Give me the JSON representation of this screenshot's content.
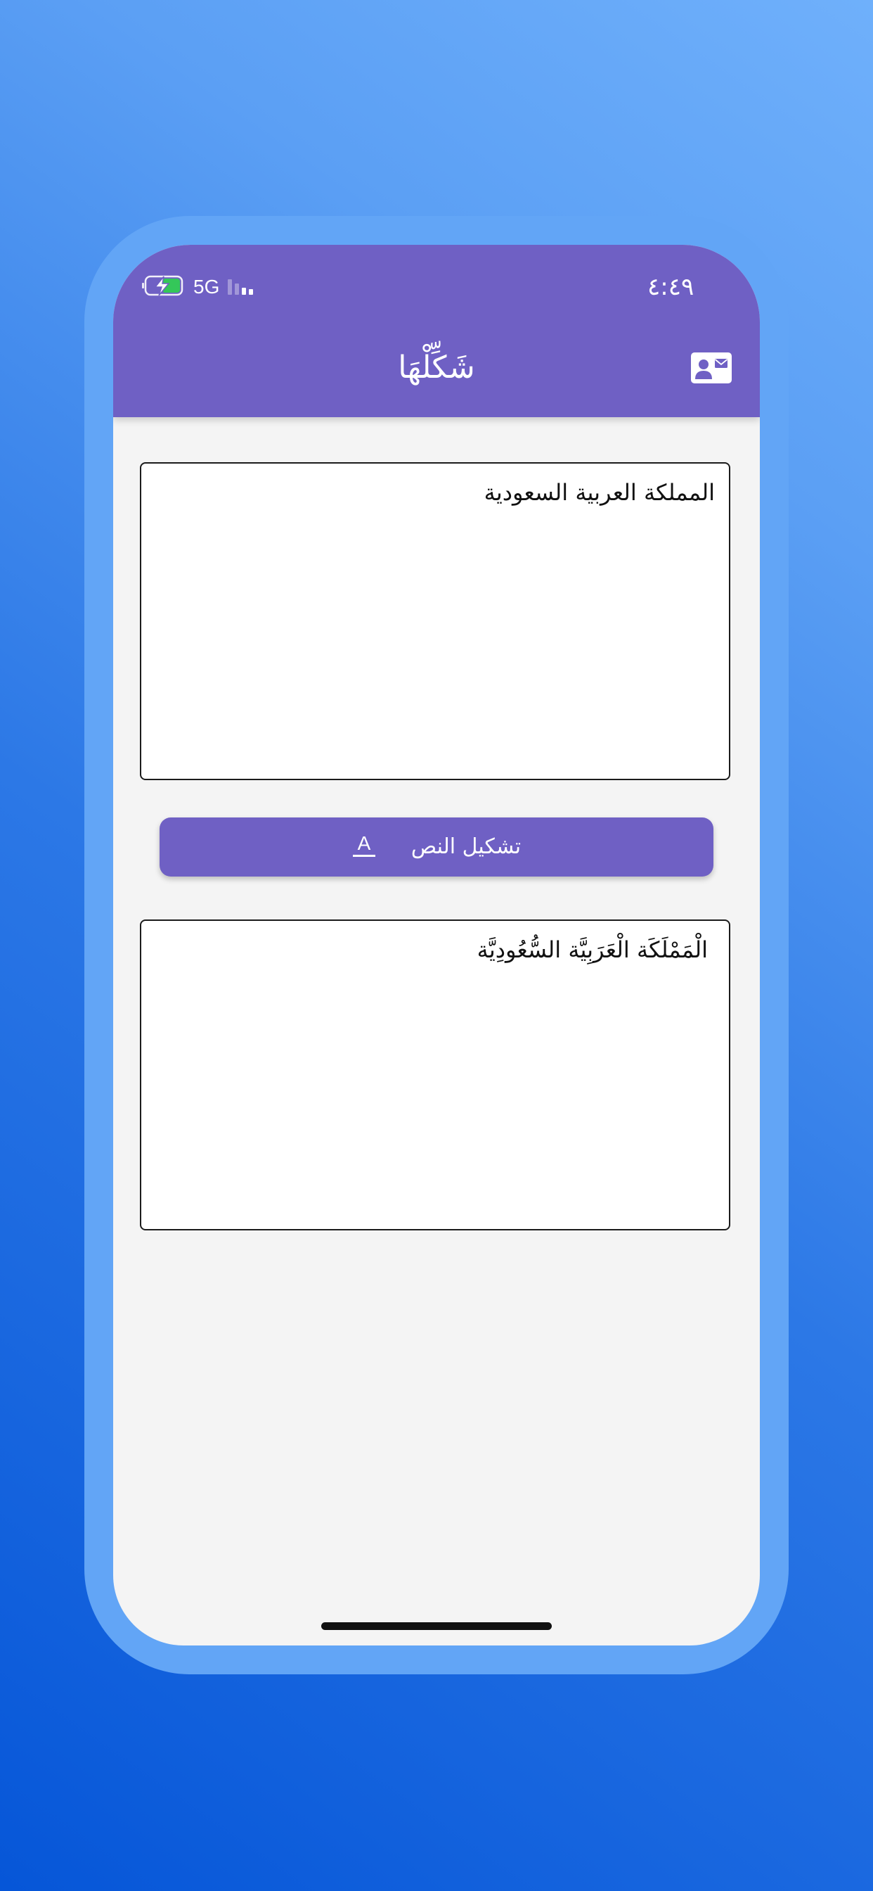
{
  "status_bar": {
    "time": "٤:٤٩",
    "network": "5G",
    "icons": [
      "battery-charging-icon",
      "signal-bars-icon"
    ]
  },
  "header": {
    "title": "شَكِّلْهَا",
    "contact_icon": "contact-card-icon"
  },
  "input": {
    "value": "المملكة العربية السعودية"
  },
  "action": {
    "label": "تشكيل النص",
    "icon": "text-format-icon"
  },
  "output": {
    "value": "الْمَمْلَكَة الْعَرَبِيَّة السُّعُودِيَّة"
  },
  "colors": {
    "primary": "#6f60c4",
    "frame": "#62a5f6",
    "background": "#f4f4f4"
  }
}
